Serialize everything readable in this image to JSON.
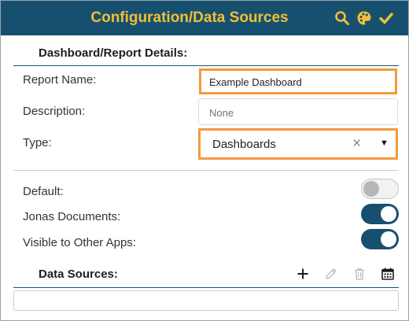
{
  "header": {
    "title": "Configuration/Data Sources"
  },
  "details": {
    "heading": "Dashboard/Report Details:",
    "report_name_label": "Report Name:",
    "report_name_value": "Example Dashboard",
    "description_label": "Description:",
    "description_placeholder": "None",
    "type_label": "Type:",
    "type_value": "Dashboards",
    "clear_glyph": "×",
    "dropdown_glyph": "▼"
  },
  "toggles": [
    {
      "label": "Default:",
      "on": false
    },
    {
      "label": "Jonas Documents:",
      "on": true
    },
    {
      "label": "Visible to Other Apps:",
      "on": true
    }
  ],
  "data_sources": {
    "heading": "Data Sources:"
  },
  "colors": {
    "header_bg": "#17506f",
    "title_color": "#f2bf34",
    "highlight": "#f39a3b",
    "toggle_on": "#17506f"
  },
  "icons": {
    "header": [
      "search-icon",
      "palette-icon",
      "checkmark-icon"
    ],
    "data_sources": [
      "add-icon",
      "edit-icon",
      "delete-icon",
      "calendar-icon"
    ]
  }
}
